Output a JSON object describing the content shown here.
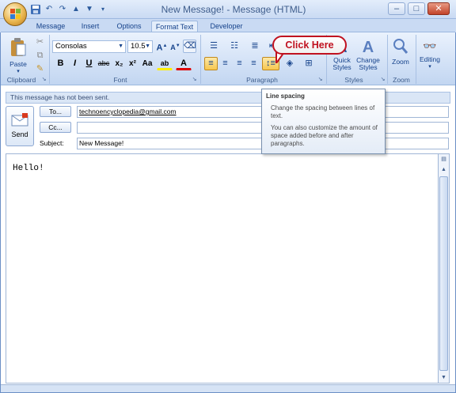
{
  "window": {
    "title": "New Message! - Message (HTML)",
    "minimize": "–",
    "maximize": "□",
    "close": "✕"
  },
  "quick_access": [
    "save-icon",
    "undo-icon",
    "redo-icon",
    "up-arrow-icon",
    "down-arrow-icon",
    "customize-icon"
  ],
  "tabs": [
    {
      "label": "Message",
      "active": false
    },
    {
      "label": "Insert",
      "active": false
    },
    {
      "label": "Options",
      "active": false
    },
    {
      "label": "Format Text",
      "active": true
    },
    {
      "label": "Developer",
      "active": false
    }
  ],
  "ribbon": {
    "clipboard": {
      "label": "Clipboard",
      "paste": "Paste"
    },
    "font": {
      "label": "Font",
      "family": "Consolas",
      "size": "10.5",
      "bold": "B",
      "italic": "I",
      "underline": "U",
      "strike": "abc",
      "subscript": "x₂",
      "superscript": "x²",
      "change_case": "Aa",
      "grow": "A",
      "shrink": "A",
      "highlight": "ab",
      "font_color": "A"
    },
    "paragraph": {
      "label": "Paragraph"
    },
    "styles": {
      "label": "Styles",
      "quick_styles": "Quick Styles",
      "change_styles": "Change Styles"
    },
    "zoom": {
      "label": "Zoom",
      "zoom": "Zoom"
    },
    "editing": {
      "label": "Editing",
      "editing": "Editing"
    }
  },
  "callout": {
    "text": "Click Here"
  },
  "tooltip": {
    "title": "Line spacing",
    "p1": "Change the spacing between lines of text.",
    "p2": "You can also customize the amount of space added before and after paragraphs."
  },
  "infobar": {
    "text": "This message has not been sent."
  },
  "compose": {
    "send": "Send",
    "to_label": "To...",
    "cc_label": "Cc...",
    "subject_label": "Subject:",
    "to_value": "technoencyclopedia@gmail.com",
    "cc_value": "",
    "subject_value": "New Message!",
    "body": "Hello!"
  },
  "colors": {
    "accent": "#15428b",
    "callout_red": "#c0111f",
    "ribbon_blue": "#d2e1f6"
  }
}
